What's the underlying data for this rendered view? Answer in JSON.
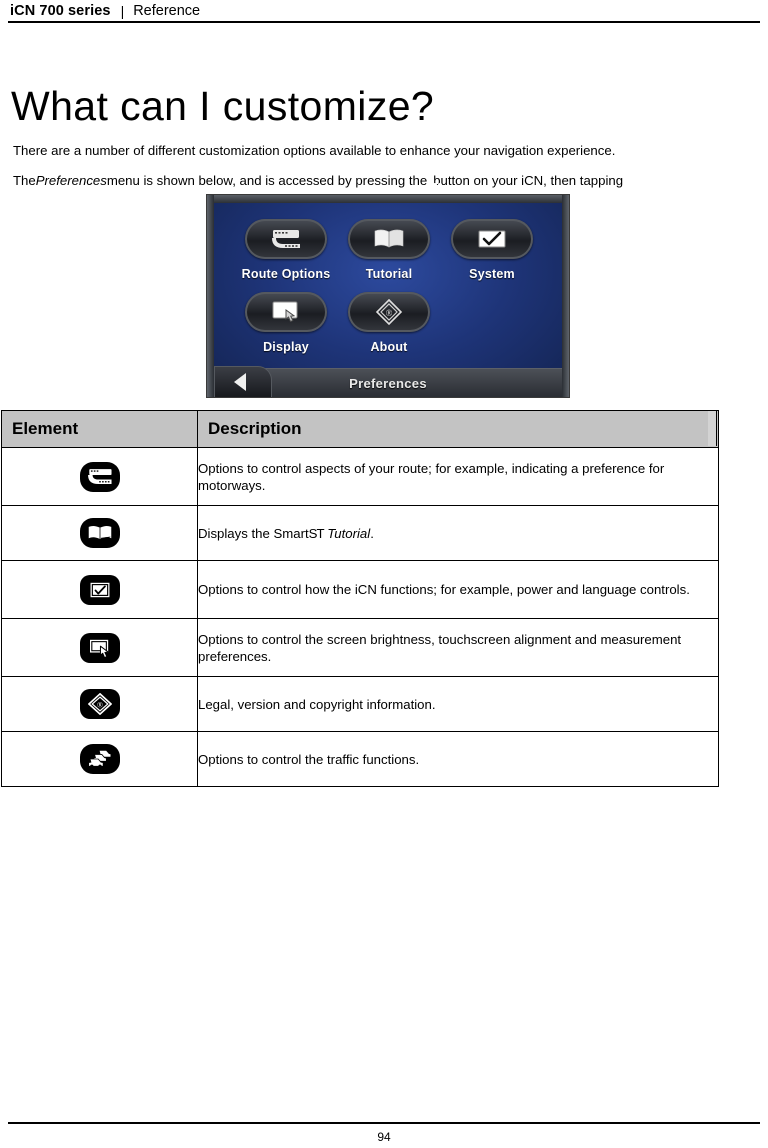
{
  "header": {
    "product": "iCN 700 series",
    "separator": "|",
    "section": "Reference"
  },
  "title": "What can I customize?",
  "paragraphs": {
    "intro": "There are a number of different customization options available to enhance your navigation experience.",
    "prefs_part1": "The ",
    "prefs_italic": "Preferences",
    "prefs_part2": " menu is shown below, and is accessed by pressing the ",
    "prefs_part3": " button on your iCN, then tapping ",
    "prefs_part4": "."
  },
  "device_screenshot": {
    "title_bar": "Preferences",
    "back_button": "back",
    "tiles": [
      {
        "label": "Route Options",
        "icon": "road-icon"
      },
      {
        "label": "Tutorial",
        "icon": "book-icon"
      },
      {
        "label": "System",
        "icon": "checkbox-icon"
      },
      {
        "label": "Display",
        "icon": "display-hand-icon"
      },
      {
        "label": "About",
        "icon": "diamond-info-icon"
      }
    ],
    "background_color": "#1e3478",
    "bezel_color": "#3a3e45"
  },
  "table": {
    "headers": [
      "Element",
      "Description"
    ],
    "header_background": "#c3c3c3",
    "rows": [
      {
        "icon": "road-icon",
        "icon_label": "Route Options",
        "description": "Options to control aspects of your route; for example, indicating a preference for motorways."
      },
      {
        "icon": "book-icon",
        "icon_label": "Tutorial",
        "description_pre": "Displays the Smart",
        "description_mark": "ST",
        "description_post_italic": "Tutorial",
        "description_post": ".",
        "description": "Displays the SmartST Tutorial."
      },
      {
        "icon": "checkbox-icon",
        "icon_label": "System",
        "description": "Options to control how the iCN functions; for example, power and language controls."
      },
      {
        "icon": "display-hand-icon",
        "icon_label": "Display",
        "description": "Options to control the screen brightness, touchscreen alignment and measurement preferences."
      },
      {
        "icon": "diamond-info-icon",
        "icon_label": "About",
        "description": "Legal, version and copyright information."
      },
      {
        "icon": "traffic-icon",
        "icon_label": "Traffic",
        "description": "Options to control the traffic functions."
      }
    ]
  },
  "footer": {
    "page_number": "94"
  }
}
